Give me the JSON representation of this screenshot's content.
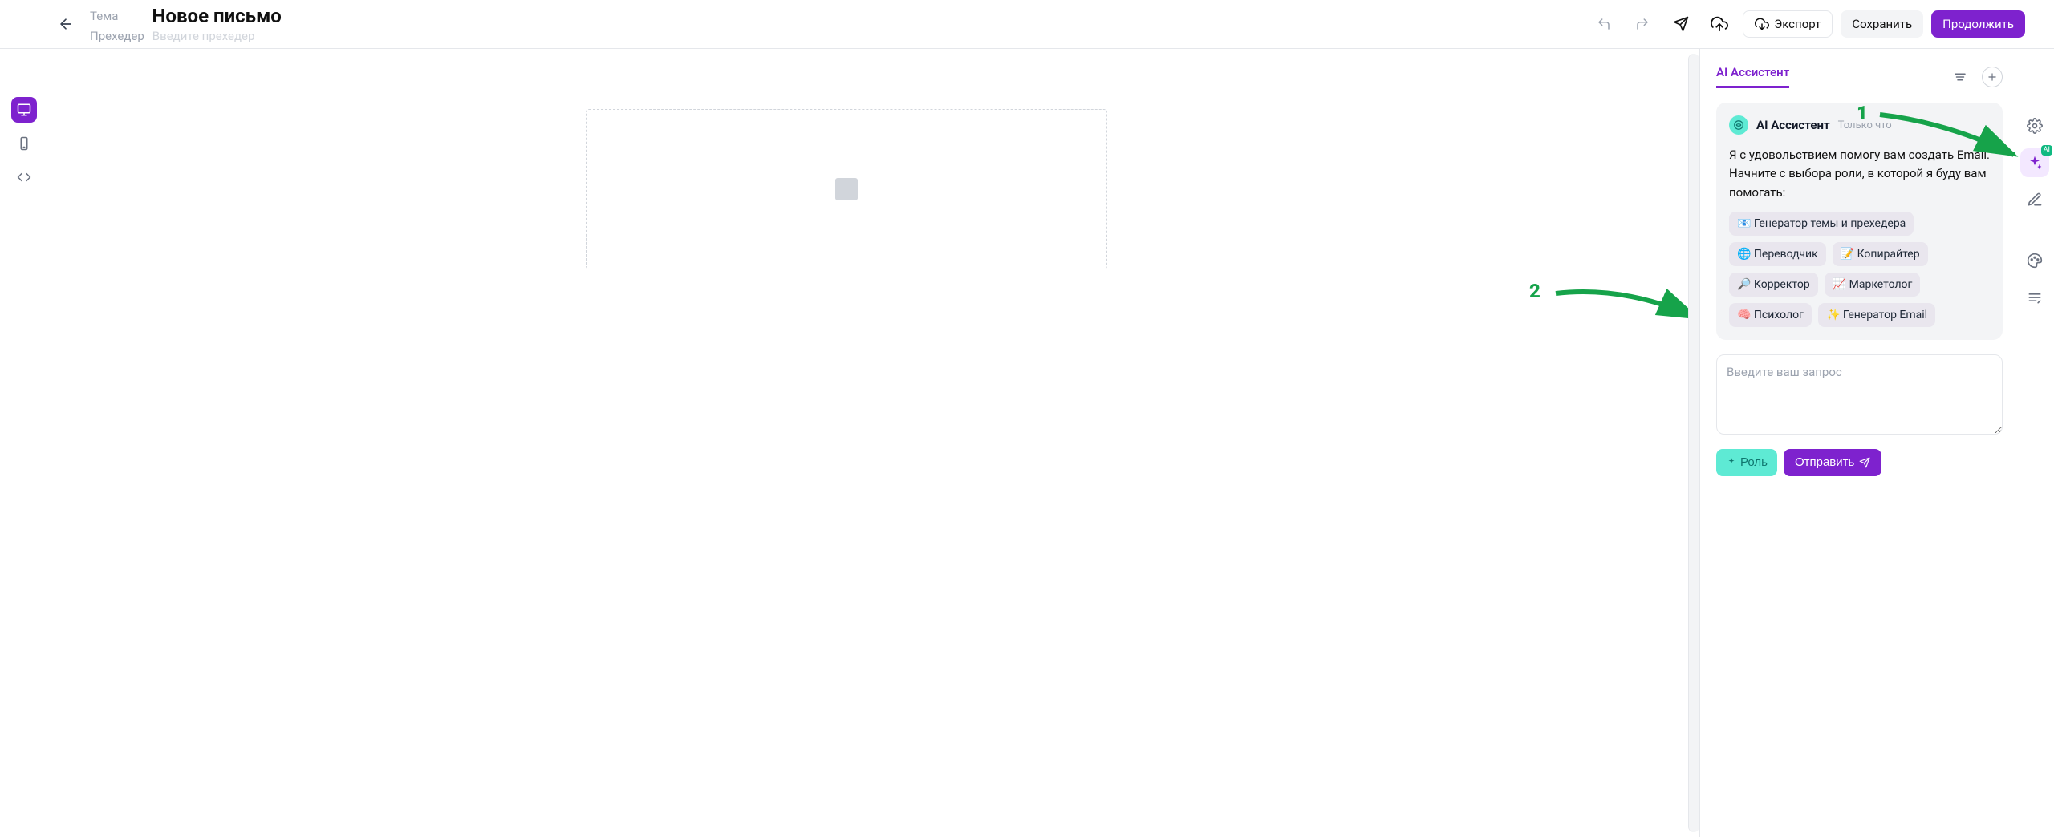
{
  "header": {
    "subject_label": "Тема",
    "subject_value": "Новое письмо",
    "preheader_label": "Прехедер",
    "preheader_placeholder": "Введите прехедер",
    "export_label": "Экспорт",
    "save_label": "Сохранить",
    "continue_label": "Продолжить"
  },
  "ai": {
    "tab_label": "AI Ассистент",
    "name": "AI Ассистент",
    "timestamp": "Только что",
    "message": "Я с удовольствием помогу вам создать Email. Начните с выбора роли, в которой я буду вам помогать:",
    "chips": [
      "📧 Генератор темы и прехедера",
      "🌐 Переводчик",
      "📝 Копирайтер",
      "🔎 Корректор",
      "📈 Маркетолог",
      "🧠 Психолог",
      "✨ Генератор Email"
    ],
    "input_placeholder": "Введите ваш запрос",
    "role_button": "Роль",
    "send_button": "Отправить"
  },
  "right_rail": {
    "ai_badge": "AI"
  },
  "annotations": {
    "label1": "1",
    "label2": "2"
  }
}
